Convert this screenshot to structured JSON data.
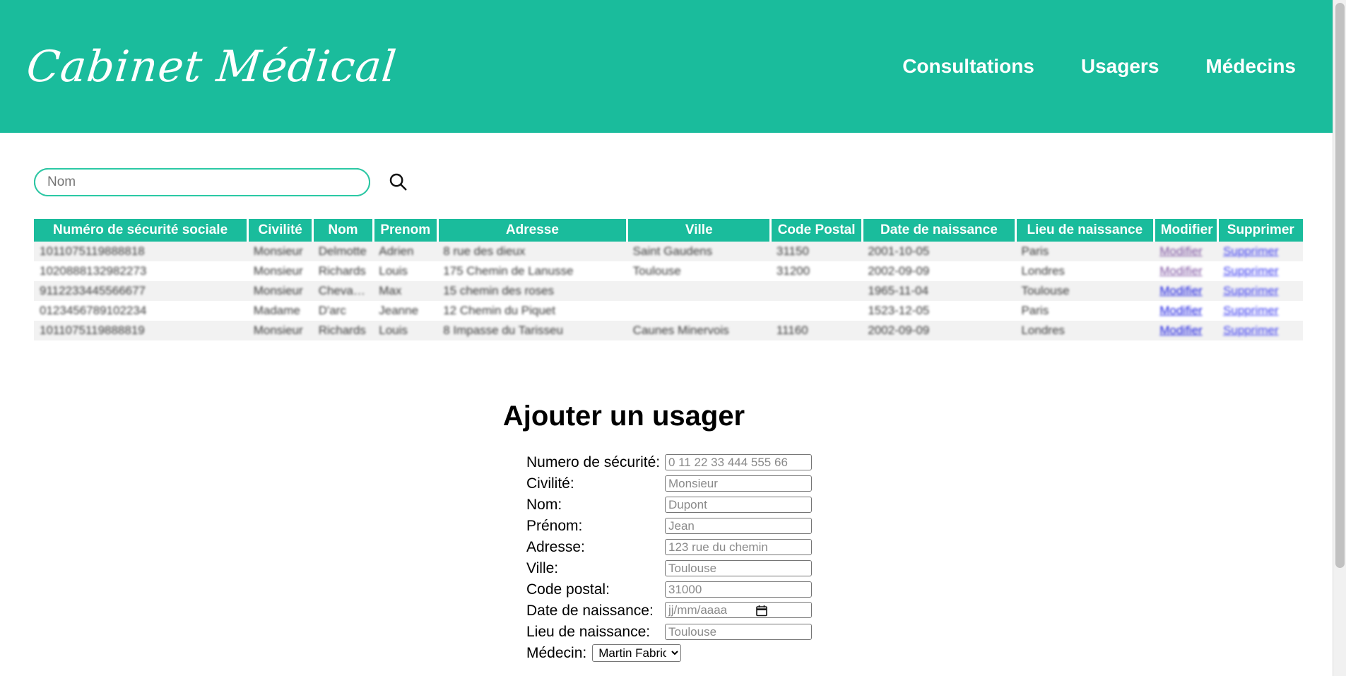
{
  "header": {
    "brand": "Cabinet Médical",
    "brand_color": "#1abc9c",
    "nav": [
      {
        "label": "Consultations",
        "name": "nav-consultations"
      },
      {
        "label": "Usagers",
        "name": "nav-usagers"
      },
      {
        "label": "Médecins",
        "name": "nav-medecins"
      }
    ]
  },
  "search": {
    "placeholder": "Nom",
    "value": "",
    "icon": "search-icon"
  },
  "table": {
    "columns": [
      "Numéro de sécurité sociale",
      "Civilité",
      "Nom",
      "Prenom",
      "Adresse",
      "Ville",
      "Code Postal",
      "Date de naissance",
      "Lieu de naissance",
      "Modifier",
      "Supprimer"
    ],
    "rows": [
      {
        "ssn": "1011075119888818",
        "civilite": "Monsieur",
        "nom": "Delmotte",
        "prenom": "Adrien",
        "adresse": "8 rue des dieux",
        "ville": "Saint Gaudens",
        "code_postal": "31150",
        "date_naissance": "2001-10-05",
        "lieu_naissance": "Paris",
        "modifier": "Modifier",
        "supprimer": "Supprimer",
        "modifier_visited": true
      },
      {
        "ssn": "1020888132982273",
        "civilite": "Monsieur",
        "nom": "Richards",
        "prenom": "Louis",
        "adresse": "175 Chemin de Lanusse",
        "ville": "Toulouse",
        "code_postal": "31200",
        "date_naissance": "2002-09-09",
        "lieu_naissance": "Londres",
        "modifier": "Modifier",
        "supprimer": "Supprimer",
        "modifier_visited": true
      },
      {
        "ssn": "9112233445566677",
        "civilite": "Monsieur",
        "nom": "Chevalier",
        "prenom": "Max",
        "adresse": "15 chemin des roses",
        "ville": "",
        "code_postal": "",
        "date_naissance": "1965-11-04",
        "lieu_naissance": "Toulouse",
        "modifier": "Modifier",
        "supprimer": "Supprimer",
        "modifier_visited": false
      },
      {
        "ssn": "0123456789102234",
        "civilite": "Madame",
        "nom": "D'arc",
        "prenom": "Jeanne",
        "adresse": "12 Chemin du Piquet",
        "ville": "",
        "code_postal": "",
        "date_naissance": "1523-12-05",
        "lieu_naissance": "Paris",
        "modifier": "Modifier",
        "supprimer": "Supprimer",
        "modifier_visited": false
      },
      {
        "ssn": "1011075119888819",
        "civilite": "Monsieur",
        "nom": "Richards",
        "prenom": "Louis",
        "adresse": "8 Impasse du Tarisseu",
        "ville": "Caunes Minervois",
        "code_postal": "11160",
        "date_naissance": "2002-09-09",
        "lieu_naissance": "Londres",
        "modifier": "Modifier",
        "supprimer": "Supprimer",
        "modifier_visited": false
      }
    ]
  },
  "form": {
    "title": "Ajouter un usager",
    "fields": [
      {
        "label": "Numero de sécurité:",
        "placeholder": "0 11 22 33 444 555 66",
        "value": "",
        "name": "numero-securite-field"
      },
      {
        "label": "Civilité:",
        "placeholder": "Monsieur",
        "value": "",
        "name": "civilite-field"
      },
      {
        "label": "Nom:",
        "placeholder": "Dupont",
        "value": "",
        "name": "nom-field"
      },
      {
        "label": "Prénom:",
        "placeholder": "Jean",
        "value": "",
        "name": "prenom-field"
      },
      {
        "label": "Adresse:",
        "placeholder": "123 rue du chemin",
        "value": "",
        "name": "adresse-field"
      },
      {
        "label": "Ville:",
        "placeholder": "Toulouse",
        "value": "",
        "name": "ville-field"
      },
      {
        "label": "Code postal:",
        "placeholder": "31000",
        "value": "",
        "name": "code-postal-field"
      }
    ],
    "date_field": {
      "label": "Date de naissance:",
      "placeholder": "jj/mm/aaaa",
      "value": ""
    },
    "lieu_field": {
      "label": "Lieu de naissance:",
      "placeholder": "Toulouse",
      "value": ""
    },
    "medecin_field": {
      "label": "Médecin:",
      "selected": "Martin Fabrice",
      "options": [
        "Martin Fabrice"
      ]
    }
  }
}
